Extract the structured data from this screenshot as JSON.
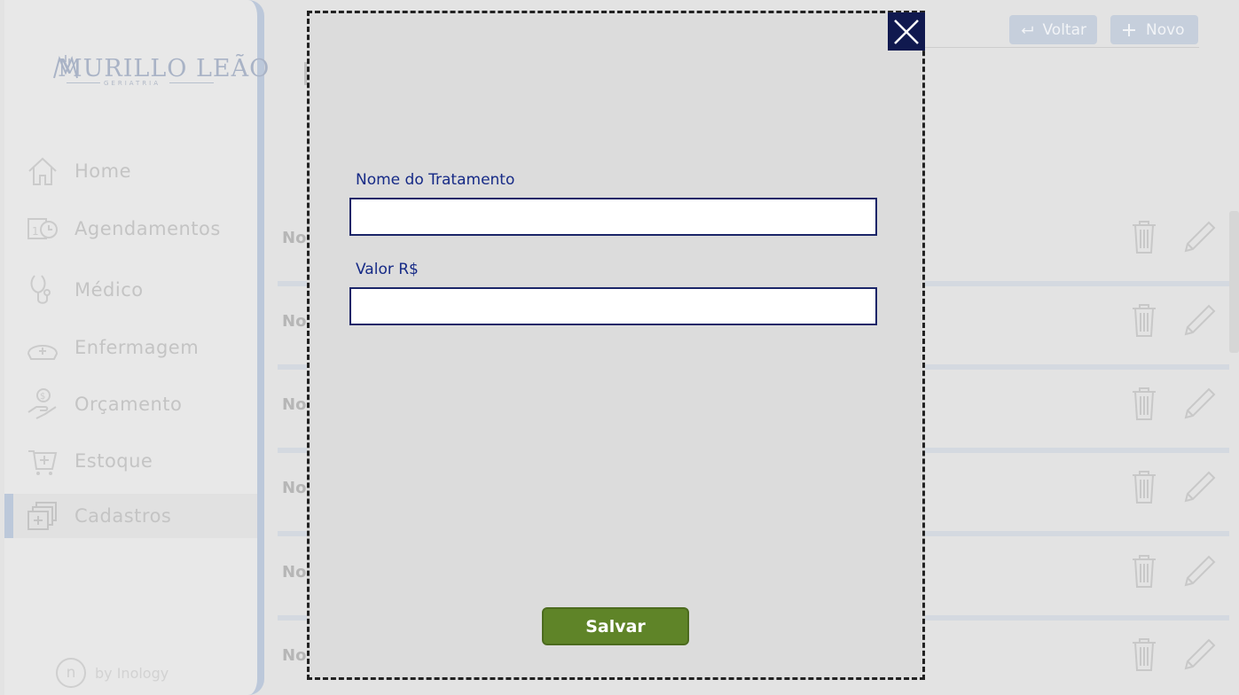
{
  "sidebar": {
    "logo_text": "MURILLO LEÃO",
    "logo_subtext": "GERIATRIA",
    "items": [
      {
        "label": "Home",
        "icon": "home-icon"
      },
      {
        "label": "Agendamentos",
        "icon": "calendar-clock-icon"
      },
      {
        "label": "Médico",
        "icon": "stethoscope-icon"
      },
      {
        "label": "Enfermagem",
        "icon": "nurse-cap-icon"
      },
      {
        "label": "Orçamento",
        "icon": "hand-money-icon"
      },
      {
        "label": "Estoque",
        "icon": "medical-cart-icon"
      },
      {
        "label": "Cadastros",
        "icon": "medical-files-icon",
        "active": true
      }
    ],
    "brand_text": "by Inology",
    "brand_letter": "n"
  },
  "toolbar": {
    "back_label": "Voltar",
    "new_label": "Novo"
  },
  "list": {
    "row_label": "No",
    "row_count": 6
  },
  "modal": {
    "name_label": "Nome do Tratamento",
    "name_value": "",
    "value_label": "Valor R$",
    "value_value": "",
    "save_label": "Salvar",
    "close_icon": "close-icon"
  },
  "colors": {
    "modal_bg": "#dcdcdc",
    "accent_navy": "#10194f",
    "label_blue": "#162a86",
    "save_green": "#5f8428",
    "sidebar_accent": "#bcc8da"
  }
}
